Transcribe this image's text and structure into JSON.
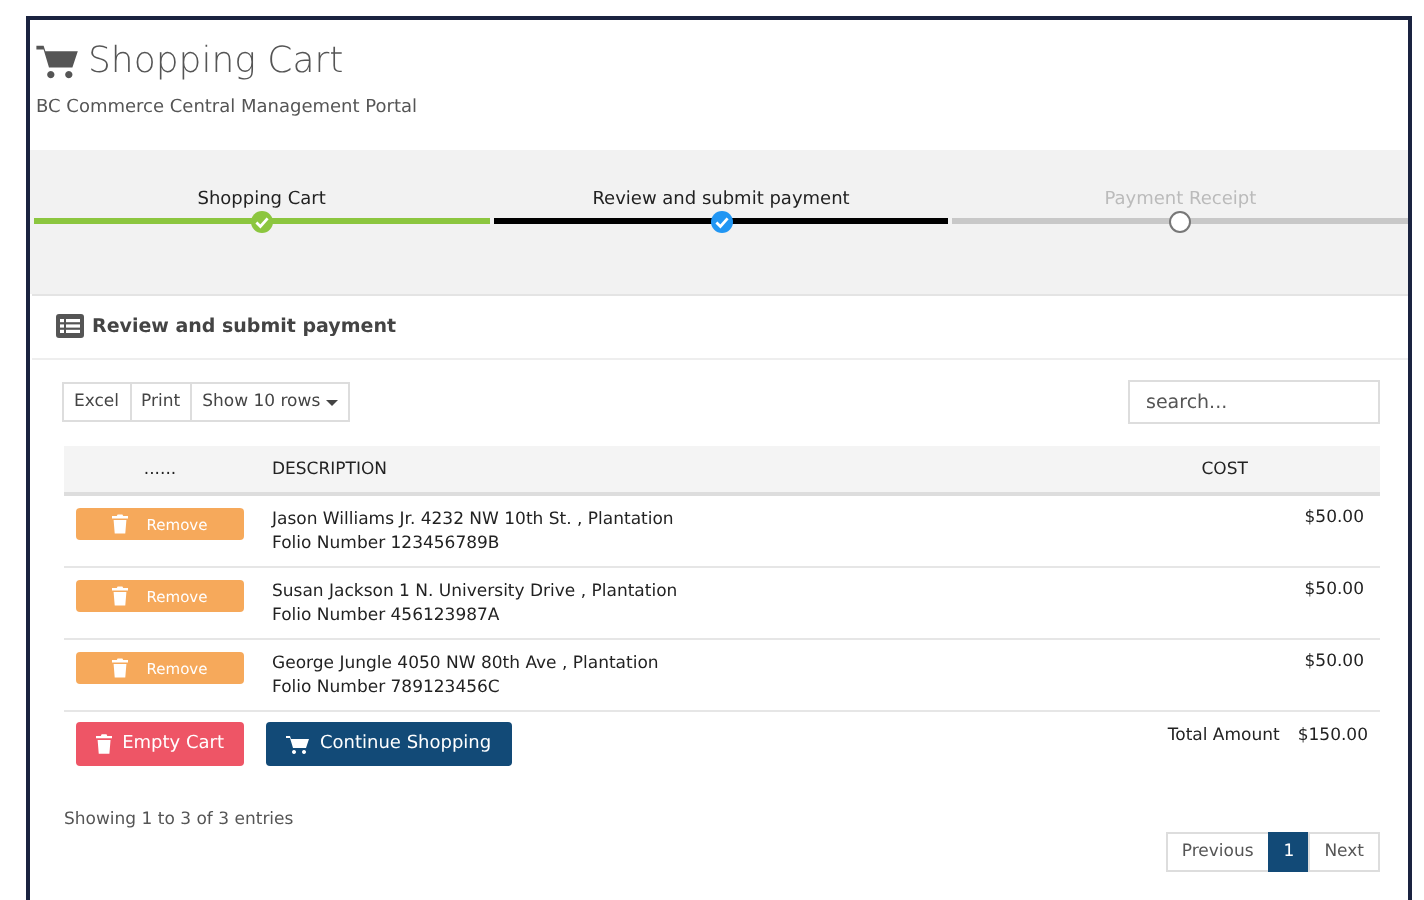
{
  "header": {
    "title": "Shopping Cart",
    "subtitle": "BC Commerce Central Management Portal"
  },
  "steps": [
    {
      "label": "Shopping Cart",
      "completed": true,
      "active": false
    },
    {
      "label": "Review and submit payment",
      "completed": true,
      "active": true
    },
    {
      "label": "Payment Receipt",
      "completed": false,
      "active": false
    }
  ],
  "panel": {
    "title": "Review and submit payment"
  },
  "toolbar": {
    "buttons": [
      "Excel",
      "Print",
      "Show 10 rows"
    ],
    "search": {
      "placeholder": "search..."
    }
  },
  "table": {
    "columns": [
      "......",
      "DESCRIPTION",
      "COST"
    ],
    "rows": [
      {
        "action": "Remove",
        "description": "Jason Williams Jr. 4232 NW 10th St. , Plantation",
        "folio": "Folio Number 123456789B",
        "cost": "$50.00"
      },
      {
        "action": "Remove",
        "description": "Susan Jackson 1 N. University Drive , Plantation",
        "folio": "Folio Number 456123987A",
        "cost": "$50.00"
      },
      {
        "action": "Remove",
        "description": "George Jungle 4050 NW 80th Ave , Plantation",
        "folio": "Folio Number 789123456C",
        "cost": "$50.00"
      }
    ]
  },
  "actions": {
    "empty": "Empty Cart",
    "continue": "Continue Shopping",
    "total_label": "Total Amount",
    "total": "$150.00"
  },
  "info": "Showing 1 to 3 of 3 entries",
  "pagination": {
    "previous": "Previous",
    "pages": [
      {
        "label": "1",
        "selected": true
      }
    ],
    "next": "Next"
  }
}
